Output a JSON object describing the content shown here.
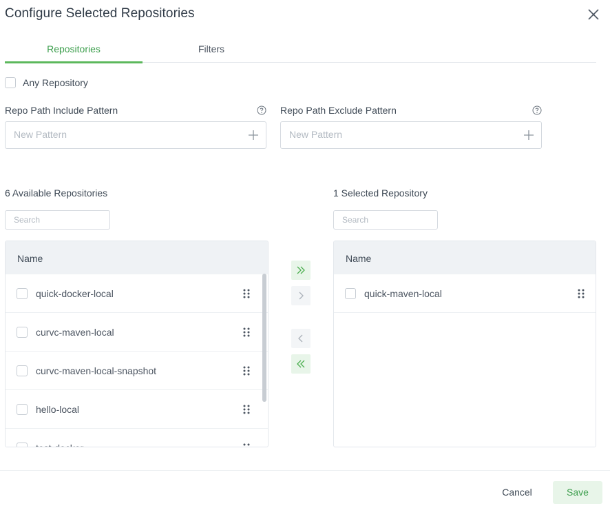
{
  "dialog": {
    "title": "Configure Selected Repositories"
  },
  "tabs": [
    {
      "label": "Repositories",
      "active": true
    },
    {
      "label": "Filters",
      "active": false
    }
  ],
  "any_repository": {
    "label": "Any Repository",
    "checked": false
  },
  "include_pattern": {
    "label": "Repo Path Include Pattern",
    "placeholder": "New Pattern",
    "value": ""
  },
  "exclude_pattern": {
    "label": "Repo Path Exclude Pattern",
    "placeholder": "New Pattern",
    "value": ""
  },
  "available": {
    "title": "6 Available Repositories",
    "search_placeholder": "Search",
    "column_header": "Name",
    "items": [
      "quick-docker-local",
      "curvc-maven-local",
      "curvc-maven-local-snapshot",
      "hello-local",
      "test-docker"
    ]
  },
  "selected": {
    "title": "1 Selected Repository",
    "search_placeholder": "Search",
    "column_header": "Name",
    "items": [
      "quick-maven-local"
    ]
  },
  "transfer_buttons": {
    "move_all_right": {
      "glyph": "»",
      "enabled": true
    },
    "move_right": {
      "glyph": "›",
      "enabled": false
    },
    "move_left": {
      "glyph": "‹",
      "enabled": false
    },
    "move_all_left": {
      "glyph": "«",
      "enabled": true
    }
  },
  "footer": {
    "cancel_label": "Cancel",
    "save_label": "Save"
  },
  "colors": {
    "accent": "#3e9f4e",
    "accent_bg": "#e8f5e9",
    "header_bg": "#eff2f5",
    "disabled_bg": "#f3f5f7"
  }
}
